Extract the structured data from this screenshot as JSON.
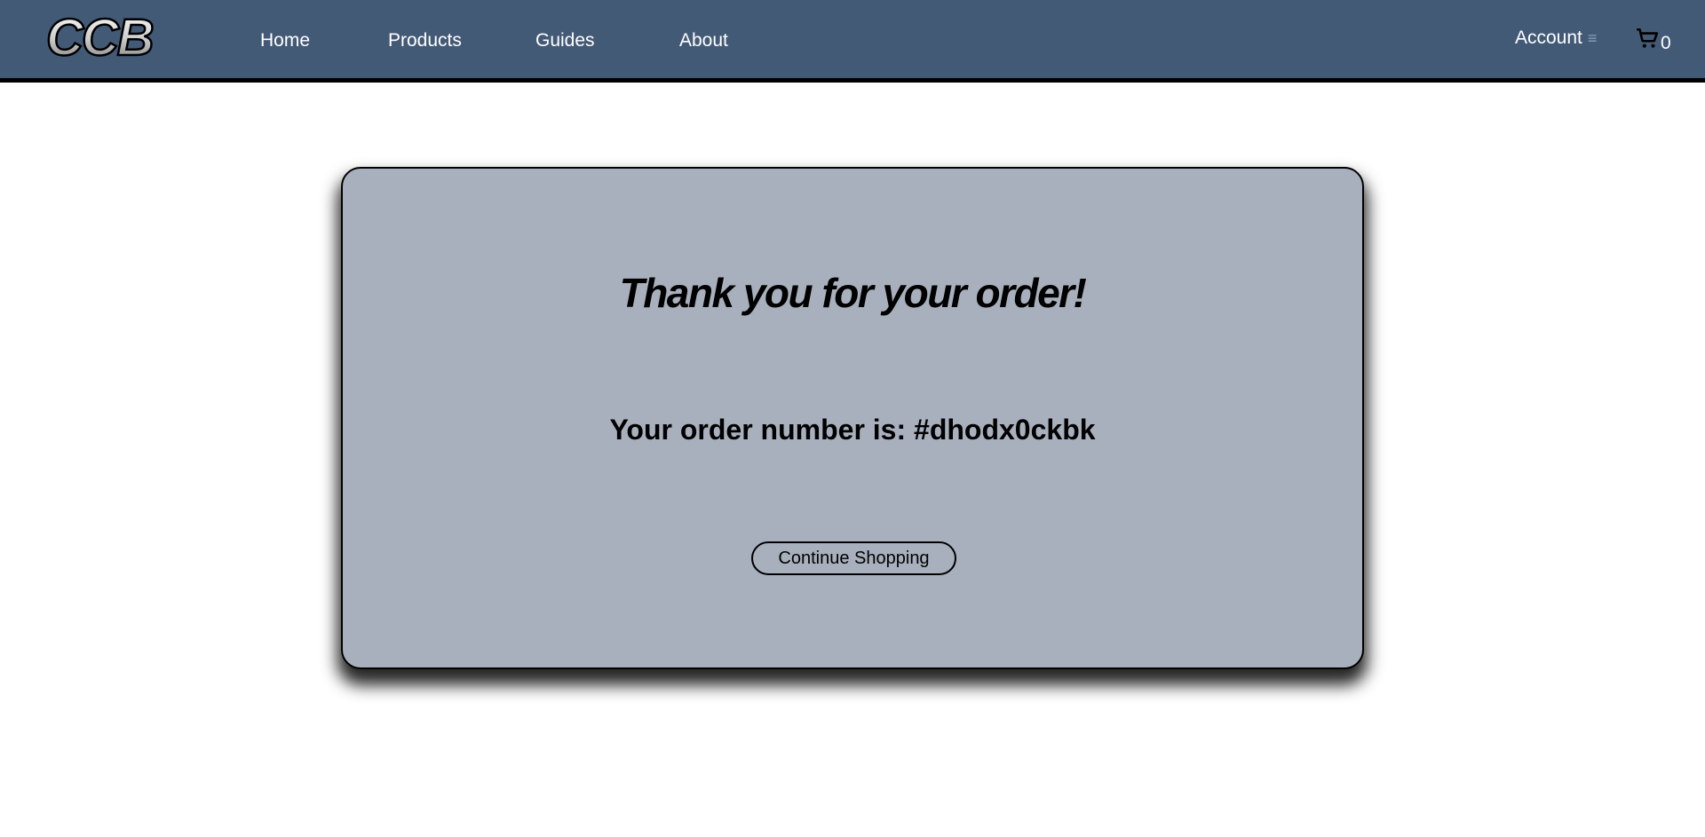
{
  "header": {
    "logo_text": "CCB",
    "nav": [
      {
        "label": "Home"
      },
      {
        "label": "Products"
      },
      {
        "label": "Guides"
      },
      {
        "label": "About"
      }
    ],
    "account_label": "Account",
    "account_menu_icon": "≡",
    "cart_icon": "cart-icon",
    "cart_count": "0"
  },
  "confirmation": {
    "title": "Thank you for your order!",
    "order_text": "Your order number is: #dhodx0ckbk",
    "continue_label": "Continue Shopping"
  },
  "colors": {
    "navbar": "#435a77",
    "card": "#a9b0bd",
    "border": "#000000"
  }
}
